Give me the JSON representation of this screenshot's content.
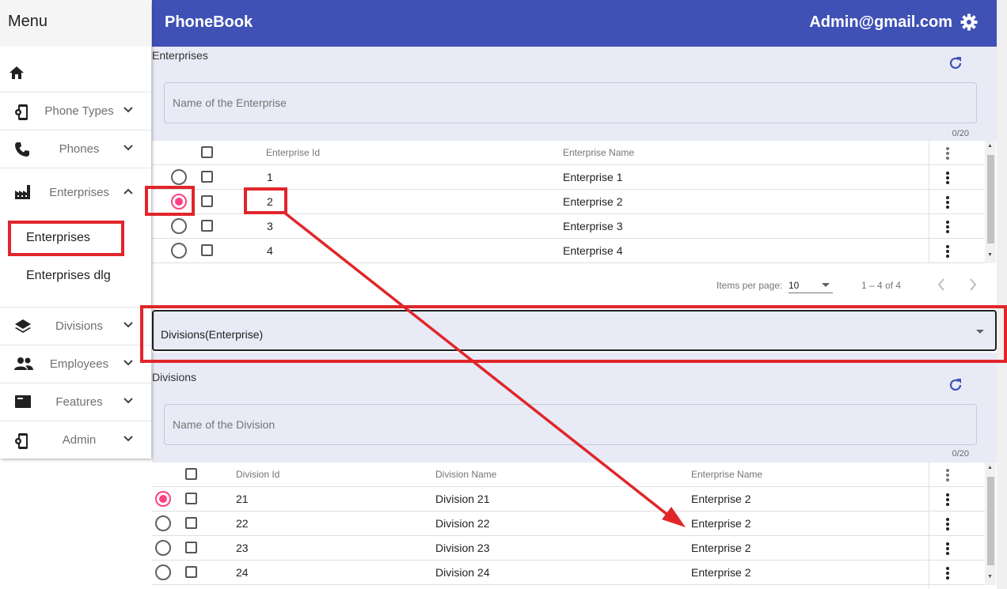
{
  "sidebar": {
    "title": "Menu",
    "items": [
      {
        "label": "Phone Types"
      },
      {
        "label": "Phones"
      },
      {
        "label": "Enterprises"
      },
      {
        "label": "Divisions"
      },
      {
        "label": "Employees"
      },
      {
        "label": "Features"
      },
      {
        "label": "Admin"
      }
    ],
    "enterprises_sub": [
      "Enterprises",
      "Enterprises dlg"
    ]
  },
  "header": {
    "app_name": "PhoneBook",
    "user": "Admin@gmail.com"
  },
  "enterprises": {
    "section_title": "Enterprises",
    "filter_placeholder": "Name of the Enterprise",
    "counter": "0/20",
    "columns": [
      "Enterprise Id",
      "Enterprise Name"
    ],
    "rows": [
      {
        "id": "1",
        "name": "Enterprise 1",
        "selected": false
      },
      {
        "id": "2",
        "name": "Enterprise 2",
        "selected": true
      },
      {
        "id": "3",
        "name": "Enterprise 3",
        "selected": false
      },
      {
        "id": "4",
        "name": "Enterprise 4",
        "selected": false
      }
    ],
    "paginator": {
      "items_per_page_label": "Items per page:",
      "page_size": "10",
      "range": "1 – 4 of 4"
    }
  },
  "division_select": {
    "value": "Divisions(Enterprise)"
  },
  "divisions": {
    "section_title": "Divisions",
    "filter_placeholder": "Name of the Division",
    "counter": "0/20",
    "columns": [
      "Division Id",
      "Division Name",
      "Enterprise Name"
    ],
    "rows": [
      {
        "id": "21",
        "name": "Division 21",
        "enterprise": "Enterprise 2",
        "selected": true
      },
      {
        "id": "22",
        "name": "Division 22",
        "enterprise": "Enterprise 2",
        "selected": false
      },
      {
        "id": "23",
        "name": "Division 23",
        "enterprise": "Enterprise 2",
        "selected": false
      },
      {
        "id": "24",
        "name": "Division 24",
        "enterprise": "Enterprise 2",
        "selected": false
      }
    ]
  },
  "colors": {
    "primary": "#3f51b5",
    "panel": "#e8eaf6",
    "accent": "#ff4081",
    "annotation": "#e0262b"
  },
  "icons": [
    "home-icon",
    "phone-types-icon",
    "phone-icon",
    "factory-icon",
    "layers-icon",
    "people-icon",
    "features-icon",
    "admin-icon",
    "gear-icon",
    "refresh-icon",
    "chevron-down-icon",
    "chevron-up-icon",
    "more-vert-icon",
    "chevron-left-icon",
    "chevron-right-icon"
  ]
}
